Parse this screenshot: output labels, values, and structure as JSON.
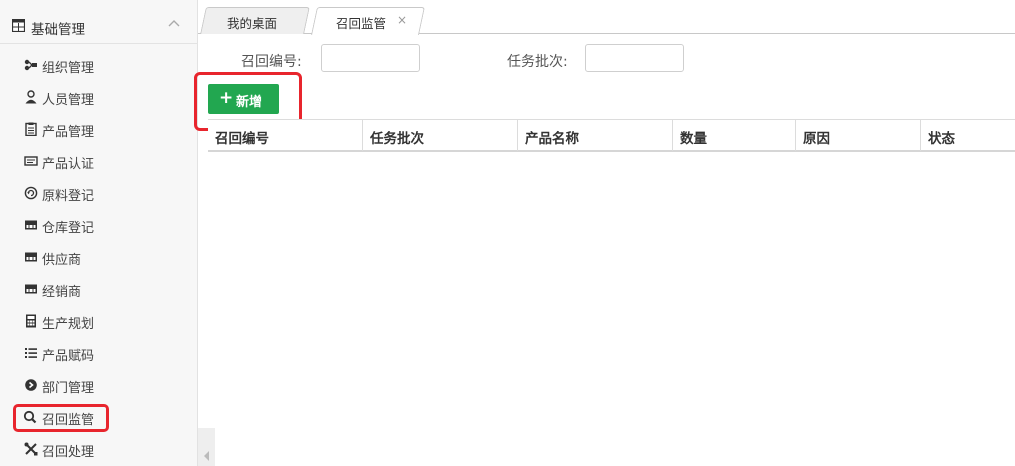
{
  "sidebar": {
    "section_title": "基础管理",
    "items": [
      {
        "label": "组织管理",
        "icon": "sitemap-icon"
      },
      {
        "label": "人员管理",
        "icon": "user-icon"
      },
      {
        "label": "产品管理",
        "icon": "clipboard-icon"
      },
      {
        "label": "产品认证",
        "icon": "card-icon"
      },
      {
        "label": "原料登记",
        "icon": "circle-arrow-icon"
      },
      {
        "label": "仓库登记",
        "icon": "warehouse-icon"
      },
      {
        "label": "供应商",
        "icon": "supplier-icon"
      },
      {
        "label": "经销商",
        "icon": "dealer-icon"
      },
      {
        "label": "生产规划",
        "icon": "calculator-icon"
      },
      {
        "label": "产品赋码",
        "icon": "list-icon"
      },
      {
        "label": "部门管理",
        "icon": "chevron-circle-icon"
      },
      {
        "label": "召回监管",
        "icon": "search-icon"
      },
      {
        "label": "召回处理",
        "icon": "tools-icon"
      }
    ]
  },
  "tabs": [
    {
      "label": "我的桌面"
    },
    {
      "label": "召回监管",
      "close": "×"
    }
  ],
  "filter": {
    "recall_no_label": "召回编号:",
    "recall_no_value": "",
    "batch_label": "任务批次:",
    "batch_value": ""
  },
  "toolbar": {
    "add_label": "新增"
  },
  "table": {
    "columns": [
      "召回编号",
      "任务批次",
      "产品名称",
      "数量",
      "原因",
      "状态"
    ]
  },
  "colors": {
    "accent_green": "#22a750",
    "highlight_red": "#e8252d"
  }
}
